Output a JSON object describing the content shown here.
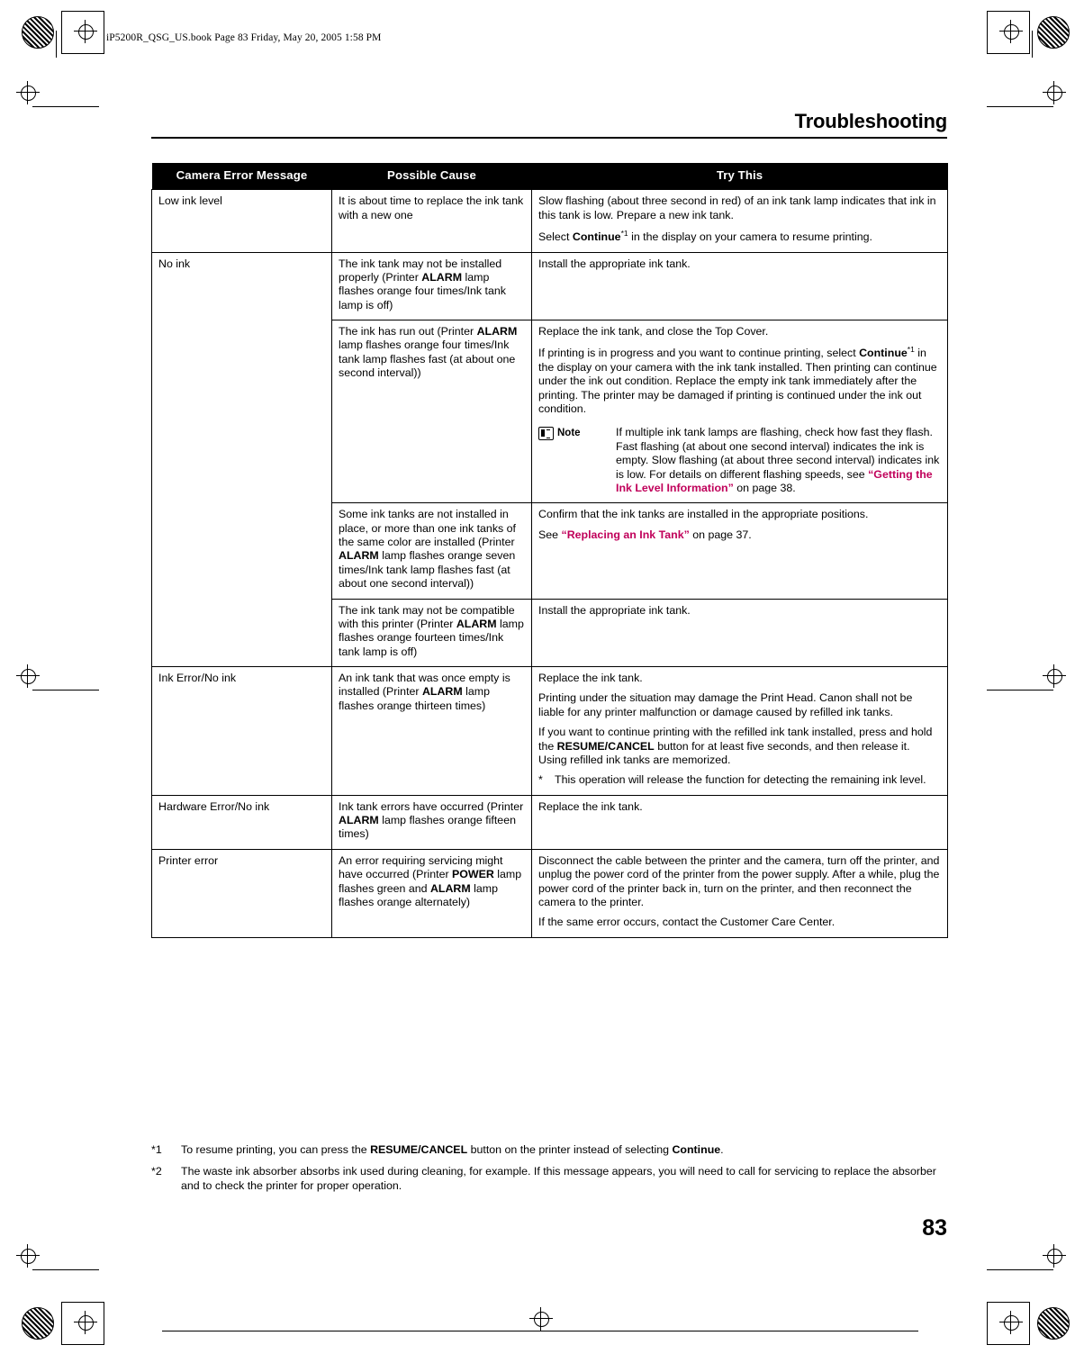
{
  "header": {
    "file_line": "iP5200R_QSG_US.book  Page 83  Friday, May 20, 2005  1:58 PM",
    "chapter_title": "Troubleshooting",
    "page_number": "83"
  },
  "table": {
    "columns": [
      "Camera Error Message",
      "Possible Cause",
      "Try This"
    ],
    "rows": [
      {
        "message": "Low ink level",
        "cause": "It is about time to replace the ink tank with a new one",
        "try": {
          "p1_a": "Slow flashing (about three second in red) of an ink tank lamp indicates that ink in this tank is low. Prepare a new ink tank.",
          "p2_a": "Select ",
          "p2_b": "Continue",
          "p2_sup": "*1",
          "p2_c": " in the display on your camera to resume printing."
        }
      },
      {
        "message": "No ink",
        "cause_a": "The ink tank may not be installed properly (Printer ",
        "cause_b": "ALARM",
        "cause_c": " lamp flashes orange four times/Ink tank lamp is off)",
        "try_a": "Install the appropriate ink tank."
      },
      {
        "cause_a": "The ink has run out (Printer ",
        "cause_b": "ALARM",
        "cause_c": " lamp flashes orange four times/Ink tank lamp flashes fast (at about one second interval))",
        "try_p1": "Replace the ink tank, and close the Top Cover.",
        "try_p2_a": "If printing is in progress and you want to continue printing, select ",
        "try_p2_b": "Continue",
        "try_p2_sup": "*1",
        "try_p2_c": " in the display on your camera with the ink tank installed. Then printing can continue under the ink out condition. Replace the empty ink tank immediately after the printing. The printer may be damaged if printing is continued under the ink out condition.",
        "note_label": "Note",
        "note_a": "If multiple ink tank lamps are flashing, check how fast they flash. Fast flashing (at about one second interval) indicates the ink is empty. Slow flashing (at about three second interval) indicates ink is low. For details on different flashing speeds, see ",
        "note_link": "“Getting the Ink Level Information”",
        "note_b": " on page 38."
      },
      {
        "cause_a": "Some ink tanks are not installed in place, or more than one ink tanks of the same color are installed (Printer ",
        "cause_b": "ALARM",
        "cause_c": " lamp flashes orange seven times/Ink tank lamp flashes fast (at about one second interval))",
        "try_p1": "Confirm that the ink tanks are installed in the appropriate positions.",
        "try_p2_a": "See ",
        "try_p2_link": "“Replacing an Ink Tank”",
        "try_p2_b": " on page 37."
      },
      {
        "cause_a": "The ink tank may not be compatible with this printer (Printer ",
        "cause_b": "ALARM",
        "cause_c": " lamp flashes orange fourteen times/Ink tank lamp is off)",
        "try_a": "Install the appropriate ink tank."
      },
      {
        "message": "Ink Error/No ink",
        "cause_a": "An ink tank that was once empty is installed (Printer ",
        "cause_b": "ALARM",
        "cause_c": " lamp flashes orange thirteen times)",
        "try_p1": "Replace the ink tank.",
        "try_p2": "Printing under the situation may damage the Print Head. Canon shall not be liable for any printer malfunction or damage caused by refilled ink tanks.",
        "try_p3_a": "If you want to continue printing with the refilled ink tank installed, press and hold the ",
        "try_p3_b": "RESUME/CANCEL",
        "try_p3_c": " button for at least five seconds, and then release it. Using refilled ink tanks are memorized.",
        "try_star": "*",
        "try_star_text": "This operation will release the function for detecting the remaining ink level."
      },
      {
        "message": "Hardware Error/No ink",
        "cause_a": "Ink tank errors have occurred (Printer ",
        "cause_b": "ALARM",
        "cause_c": " lamp flashes orange fifteen times)",
        "try_a": "Replace the ink tank."
      },
      {
        "message": "Printer error",
        "cause_a": "An error requiring servicing might have occurred (Printer ",
        "cause_b": "POWER",
        "cause_c": " lamp flashes green and ",
        "cause_d": "ALARM",
        "cause_e": " lamp flashes orange alternately)",
        "try_p1": "Disconnect the cable between the printer and the camera, turn off the printer, and unplug the power cord of the printer from the power supply. After a while, plug the power cord of the printer back in, turn on the printer, and then reconnect the camera to the printer.",
        "try_p2": "If the same error occurs, contact the Customer Care Center."
      }
    ]
  },
  "footnotes": [
    {
      "mark": "*1",
      "a": "To resume printing, you can press the ",
      "b": "RESUME/CANCEL",
      "c": " button on the printer instead of selecting ",
      "d": "Continue",
      "e": "."
    },
    {
      "mark": "*2",
      "a": "The waste ink absorber absorbs ink used during cleaning, for example. If this message appears, you will need to call for servicing to replace the absorber and to check the printer for proper operation."
    }
  ],
  "colors": {
    "link": "#c0005a",
    "header_bg": "#000000"
  }
}
